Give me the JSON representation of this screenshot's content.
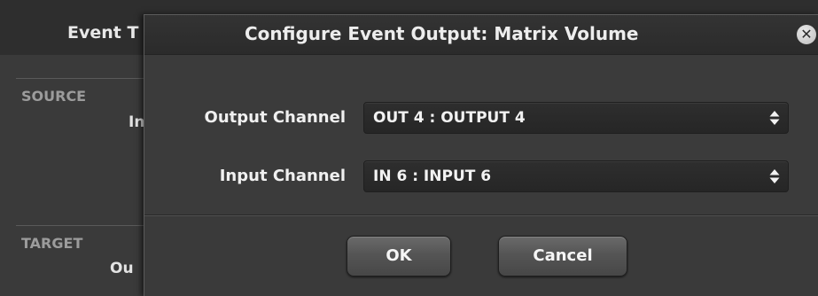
{
  "background": {
    "header_title": "Event T",
    "source_label": "SOURCE",
    "source_sub": "In",
    "target_label": "TARGET",
    "target_sub": "Ou"
  },
  "dialog": {
    "title": "Configure Event Output: Matrix Volume",
    "close_glyph": "✕",
    "fields": [
      {
        "label": "Output Channel",
        "value": "OUT 4 : OUTPUT 4",
        "icon": "updown-icon"
      },
      {
        "label": "Input Channel",
        "value": "IN 6 : INPUT 6",
        "icon": "updown-icon"
      }
    ],
    "ok_label": "OK",
    "cancel_label": "Cancel"
  }
}
